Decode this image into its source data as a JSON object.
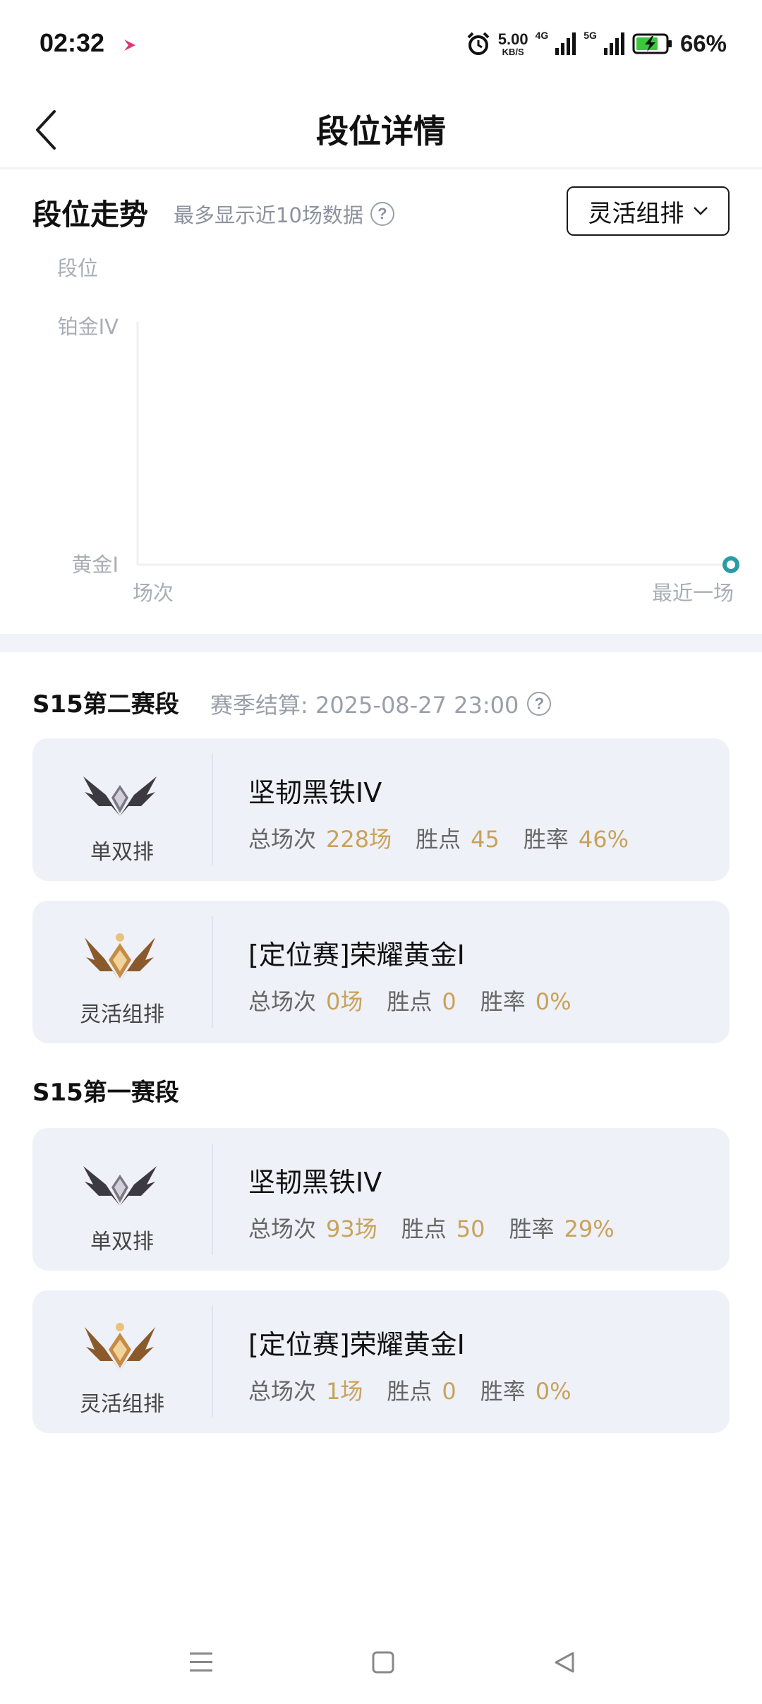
{
  "status_bar": {
    "time": "02:32",
    "net_speed_value": "5.00",
    "net_speed_unit": "KB/S",
    "signal1_label": "4G",
    "signal2_label": "5G",
    "battery_percent": "66%",
    "battery_color": "#3cc83c"
  },
  "header": {
    "title": "段位详情"
  },
  "trend": {
    "title": "段位走势",
    "subtitle": "最多显示近10场数据",
    "mode_selected": "灵活组排"
  },
  "chart_data": {
    "type": "line",
    "ylabel": "段位",
    "y_ticks": [
      "铂金IV",
      "黄金I"
    ],
    "xlabel_start": "场次",
    "xlabel_end": "最近一场",
    "series": [
      {
        "points": [
          {
            "x": "最近一场",
            "y": "黄金I"
          }
        ]
      }
    ],
    "marker_color": "#2a9ca6"
  },
  "seasons": [
    {
      "title": "S15第二赛段",
      "settle": "赛季结算: 2025-08-27 23:00",
      "cards": [
        {
          "queue": "单双排",
          "emblem": "iron-emblem-icon",
          "rank": "坚韧黑铁IV",
          "games_label": "总场次",
          "games": "228场",
          "points_label": "胜点",
          "points": "45",
          "winrate_label": "胜率",
          "winrate": "46%"
        },
        {
          "queue": "灵活组排",
          "emblem": "gold-emblem-icon",
          "rank": "[定位赛]荣耀黄金I",
          "games_label": "总场次",
          "games": "0场",
          "points_label": "胜点",
          "points": "0",
          "winrate_label": "胜率",
          "winrate": "0%"
        }
      ]
    },
    {
      "title": "S15第一赛段",
      "settle": "",
      "cards": [
        {
          "queue": "单双排",
          "emblem": "iron-emblem-icon",
          "rank": "坚韧黑铁IV",
          "games_label": "总场次",
          "games": "93场",
          "points_label": "胜点",
          "points": "50",
          "winrate_label": "胜率",
          "winrate": "29%"
        },
        {
          "queue": "灵活组排",
          "emblem": "gold-emblem-icon",
          "rank": "[定位赛]荣耀黄金I",
          "games_label": "总场次",
          "games": "1场",
          "points_label": "胜点",
          "points": "0",
          "winrate_label": "胜率",
          "winrate": "0%"
        }
      ]
    }
  ],
  "colors": {
    "accent_value": "#c9a25a",
    "card_bg": "#eef1f7"
  }
}
